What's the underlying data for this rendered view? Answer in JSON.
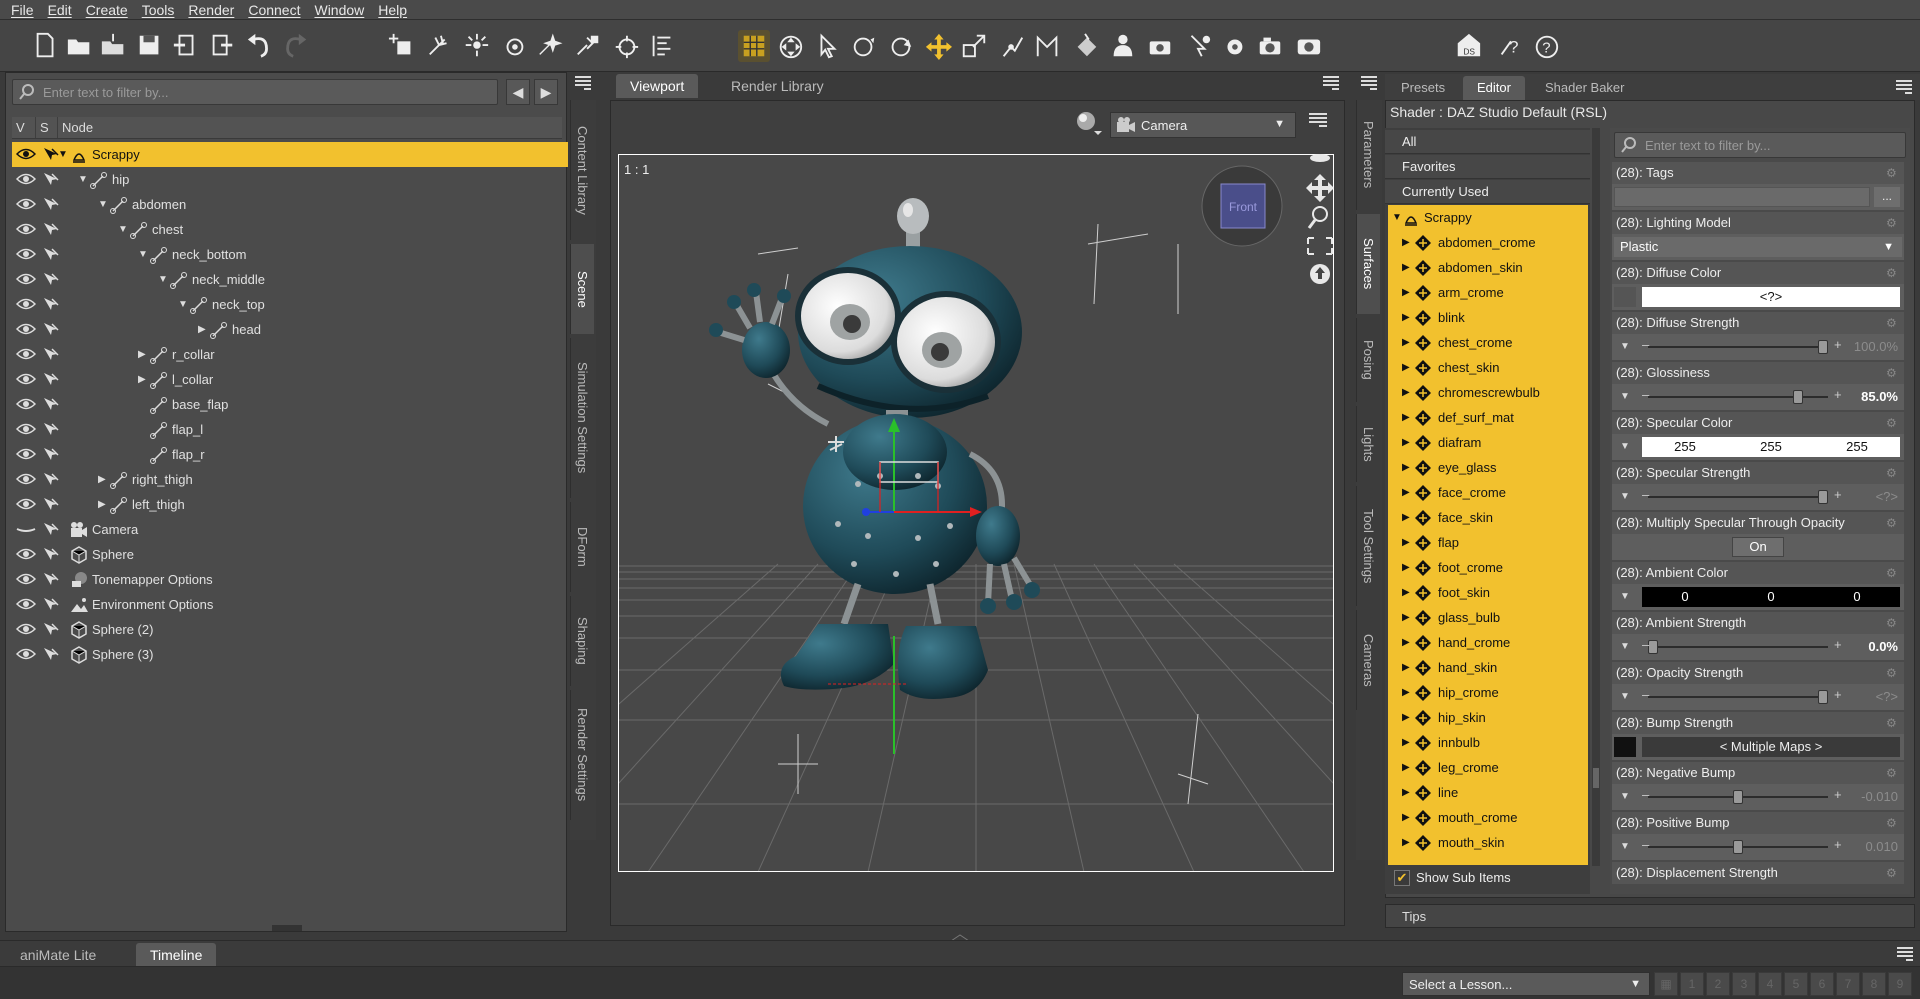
{
  "menu": [
    "File",
    "Edit",
    "Create",
    "Tools",
    "Render",
    "Connect",
    "Window",
    "Help"
  ],
  "scene_pane": {
    "filter_placeholder": "Enter text to filter by...",
    "columns": [
      "V",
      "S",
      "Node"
    ],
    "nodes": [
      {
        "label": "Scrappy",
        "depth": 0,
        "arrow": "▼",
        "icon": "figure-icon",
        "selected": true
      },
      {
        "label": "hip",
        "depth": 1,
        "arrow": "▼",
        "icon": "bone-icon"
      },
      {
        "label": "abdomen",
        "depth": 2,
        "arrow": "▼",
        "icon": "bone-icon"
      },
      {
        "label": "chest",
        "depth": 3,
        "arrow": "▼",
        "icon": "bone-icon"
      },
      {
        "label": "neck_bottom",
        "depth": 4,
        "arrow": "▼",
        "icon": "bone-icon"
      },
      {
        "label": "neck_middle",
        "depth": 5,
        "arrow": "▼",
        "icon": "bone-icon"
      },
      {
        "label": "neck_top",
        "depth": 6,
        "arrow": "▼",
        "icon": "bone-icon"
      },
      {
        "label": "head",
        "depth": 7,
        "arrow": "▶",
        "icon": "bone-icon"
      },
      {
        "label": "r_collar",
        "depth": 4,
        "arrow": "▶",
        "icon": "bone-icon"
      },
      {
        "label": "l_collar",
        "depth": 4,
        "arrow": "▶",
        "icon": "bone-icon"
      },
      {
        "label": "base_flap",
        "depth": 4,
        "arrow": "",
        "icon": "bone-icon"
      },
      {
        "label": "flap_l",
        "depth": 4,
        "arrow": "",
        "icon": "bone-icon"
      },
      {
        "label": "flap_r",
        "depth": 4,
        "arrow": "",
        "icon": "bone-icon"
      },
      {
        "label": "right_thigh",
        "depth": 2,
        "arrow": "▶",
        "icon": "bone-icon"
      },
      {
        "label": "left_thigh",
        "depth": 2,
        "arrow": "▶",
        "icon": "bone-icon"
      },
      {
        "label": "Camera",
        "depth": 0,
        "arrow": "",
        "icon": "camera-icon"
      },
      {
        "label": "Sphere",
        "depth": 0,
        "arrow": "",
        "icon": "sphere-icon"
      },
      {
        "label": "Tonemapper Options",
        "depth": 0,
        "arrow": "",
        "icon": "tonemapper-icon"
      },
      {
        "label": "Environment Options",
        "depth": 0,
        "arrow": "",
        "icon": "environment-icon"
      },
      {
        "label": "Sphere (2)",
        "depth": 0,
        "arrow": "",
        "icon": "sphere-icon"
      },
      {
        "label": "Sphere (3)",
        "depth": 0,
        "arrow": "",
        "icon": "sphere-icon"
      }
    ]
  },
  "left_side_tabs": [
    "Content Library",
    "Scene",
    "Simulation Settings",
    "DForm",
    "Shaping",
    "Render Settings"
  ],
  "viewport": {
    "tabs": [
      "Viewport",
      "Render Library"
    ],
    "camera": "Camera",
    "aspect_label": "1 : 1",
    "cube_label": "Front"
  },
  "right_side_tabs": [
    "Parameters",
    "Surfaces",
    "Posing",
    "Lights",
    "Tool Settings",
    "Cameras"
  ],
  "surfaces": {
    "tabs": [
      "Presets",
      "Editor",
      "Shader Baker"
    ],
    "shader": "Shader : DAZ Studio Default (RSL)",
    "categories": [
      "All",
      "Favorites",
      "Currently Used"
    ],
    "root": "Scrappy",
    "materials": [
      "abdomen_crome",
      "abdomen_skin",
      "arm_crome",
      "blink",
      "chest_crome",
      "chest_skin",
      "chromescrewbulb",
      "def_surf_mat",
      "diafram",
      "eye_glass",
      "face_crome",
      "face_skin",
      "flap",
      "foot_crome",
      "foot_skin",
      "glass_bulb",
      "hand_crome",
      "hand_skin",
      "hip_crome",
      "hip_skin",
      "innbulb",
      "leg_crome",
      "line",
      "mouth_crome",
      "mouth_skin"
    ],
    "show_sub_items": "Show Sub Items",
    "filter_placeholder": "Enter text to filter by...",
    "tips": "Tips"
  },
  "params": [
    {
      "title": "(28): Tags",
      "kind": "text",
      "button": "..."
    },
    {
      "title": "(28): Lighting Model",
      "kind": "select",
      "value": "Plastic"
    },
    {
      "title": "(28): Diffuse Color",
      "kind": "color",
      "value": "<?>"
    },
    {
      "title": "(28): Diffuse Strength",
      "kind": "slider",
      "value": "100.0%",
      "dim": true,
      "level": 1.0
    },
    {
      "title": "(28): Glossiness",
      "kind": "slider",
      "value": "85.0%",
      "dim": false,
      "level": 0.85
    },
    {
      "title": "(28): Specular Color",
      "kind": "rgb",
      "values": [
        "255",
        "255",
        "255"
      ],
      "tone": "white"
    },
    {
      "title": "(28): Specular Strength",
      "kind": "slider",
      "value": "<?>",
      "dim": true,
      "level": 1.0
    },
    {
      "title": "(28): Multiply Specular Through Opacity",
      "kind": "toggle",
      "value": "On"
    },
    {
      "title": "(28): Ambient Color",
      "kind": "rgb",
      "values": [
        "0",
        "0",
        "0"
      ],
      "tone": "black"
    },
    {
      "title": "(28): Ambient Strength",
      "kind": "slider",
      "value": "0.0%",
      "dim": false,
      "level": 0.0
    },
    {
      "title": "(28): Opacity Strength",
      "kind": "slider",
      "value": "<?>",
      "dim": true,
      "level": 1.0
    },
    {
      "title": "(28): Bump Strength",
      "kind": "map",
      "value": "< Multiple Maps >"
    },
    {
      "title": "(28): Negative Bump",
      "kind": "slider",
      "value": "-0.010",
      "dim": true,
      "level": 0.5
    },
    {
      "title": "(28): Positive Bump",
      "kind": "slider",
      "value": "0.010",
      "dim": true,
      "level": 0.5
    },
    {
      "title": "(28): Displacement Strength",
      "kind": "partial"
    }
  ],
  "bottom": {
    "tabs": [
      "aniMate Lite",
      "Timeline"
    ],
    "lesson": "Select a Lesson...",
    "pages": [
      "1",
      "2",
      "3",
      "4",
      "5",
      "6",
      "7",
      "8",
      "9"
    ]
  },
  "colors": {
    "selection": "#f2c12e",
    "panel": "#4b4b4b",
    "robot": "#1f4a58"
  }
}
